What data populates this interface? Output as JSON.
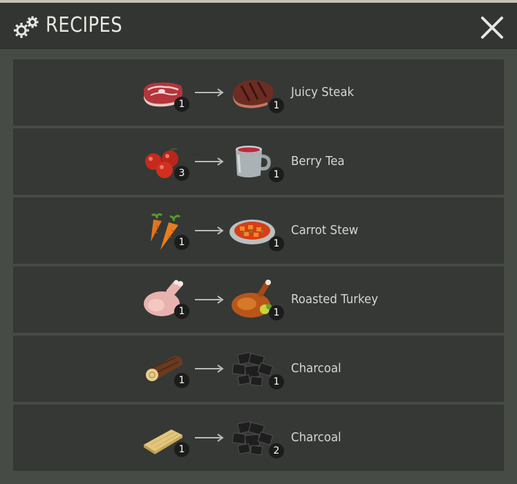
{
  "header": {
    "title": "RECIPES",
    "icon": "gears-icon",
    "close_icon": "close-icon"
  },
  "colors": {
    "background": "#474b45",
    "header": "#323532",
    "row": "#353835",
    "text": "#d6d6d0",
    "badge": "#1b1c1b"
  },
  "recipes": [
    {
      "ingredient_icon": "raw-meat-icon",
      "ingredient_qty": "1",
      "result_icon": "steak-icon",
      "result_qty": "1",
      "name": "Juicy Steak"
    },
    {
      "ingredient_icon": "red-berries-icon",
      "ingredient_qty": "3",
      "result_icon": "tea-mug-icon",
      "result_qty": "1",
      "name": "Berry Tea"
    },
    {
      "ingredient_icon": "carrots-icon",
      "ingredient_qty": "1",
      "result_icon": "stew-plate-icon",
      "result_qty": "1",
      "name": "Carrot Stew"
    },
    {
      "ingredient_icon": "raw-turkey-icon",
      "ingredient_qty": "1",
      "result_icon": "roasted-turkey-icon",
      "result_qty": "1",
      "name": "Roasted Turkey"
    },
    {
      "ingredient_icon": "log-icon",
      "ingredient_qty": "1",
      "result_icon": "charcoal-icon",
      "result_qty": "1",
      "name": "Charcoal"
    },
    {
      "ingredient_icon": "plank-icon",
      "ingredient_qty": "1",
      "result_icon": "charcoal-icon",
      "result_qty": "2",
      "name": "Charcoal"
    }
  ]
}
